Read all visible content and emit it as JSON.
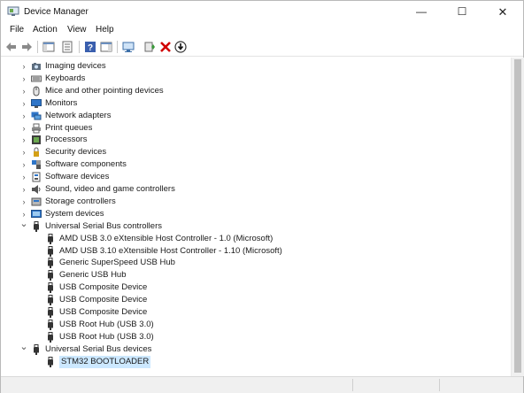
{
  "window": {
    "title": "Device Manager",
    "minimize_glyph": "—",
    "maximize_glyph": "☐",
    "close_glyph": "✕"
  },
  "menu": [
    "File",
    "Action",
    "View",
    "Help"
  ],
  "toolbar": {
    "buttons": [
      "back-arrow-icon",
      "forward-arrow-icon",
      "show-hide-console-tree-icon",
      "properties-icon",
      "help-icon",
      "action-pane-icon",
      "scan-hardware-changes-icon",
      "update-driver-icon",
      "uninstall-device-icon",
      "disable-device-icon"
    ]
  },
  "tree": {
    "categories_collapsed": [
      {
        "label": "Imaging devices",
        "icon": "imaging-devices-icon"
      },
      {
        "label": "Keyboards",
        "icon": "keyboard-icon"
      },
      {
        "label": "Mice and other pointing devices",
        "icon": "mouse-icon"
      },
      {
        "label": "Monitors",
        "icon": "monitor-icon"
      },
      {
        "label": "Network adapters",
        "icon": "network-adapter-icon"
      },
      {
        "label": "Print queues",
        "icon": "printer-icon"
      },
      {
        "label": "Processors",
        "icon": "processor-icon"
      },
      {
        "label": "Security devices",
        "icon": "security-device-icon"
      },
      {
        "label": "Software components",
        "icon": "software-component-icon"
      },
      {
        "label": "Software devices",
        "icon": "software-device-icon"
      },
      {
        "label": "Sound, video and game controllers",
        "icon": "speaker-icon"
      },
      {
        "label": "Storage controllers",
        "icon": "storage-controller-icon"
      },
      {
        "label": "System devices",
        "icon": "system-device-icon"
      }
    ],
    "usb_controllers": {
      "label": "Universal Serial Bus controllers",
      "icon": "usb-icon",
      "children": [
        "AMD USB 3.0 eXtensible Host Controller - 1.0 (Microsoft)",
        "AMD USB 3.10 eXtensible Host Controller - 1.10 (Microsoft)",
        "Generic SuperSpeed USB Hub",
        "Generic USB Hub",
        "USB Composite Device",
        "USB Composite Device",
        "USB Composite Device",
        "USB Root Hub (USB 3.0)",
        "USB Root Hub (USB 3.0)"
      ]
    },
    "usb_devices": {
      "label": "Universal Serial Bus devices",
      "icon": "usb-icon",
      "children": [
        "STM32  BOOTLOADER"
      ],
      "selected_child": "STM32  BOOTLOADER"
    },
    "expanded_glyph": "⌄",
    "collapsed_glyph": "›"
  },
  "colors": {
    "selection": "#cce8ff",
    "icon_blue": "#2e75c8",
    "uninstall_red": "#d00000"
  }
}
